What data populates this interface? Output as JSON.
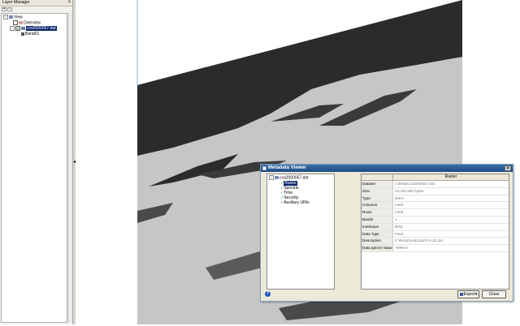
{
  "layer_manager": {
    "title": "Layer Manager",
    "close_glyph": "×",
    "toolbar": [
      "+",
      "−"
    ],
    "tree": [
      {
        "label": "View",
        "depth": 0,
        "icon": "view-icon"
      },
      {
        "label": "Overview",
        "depth": 1,
        "icon": "overview-icon"
      },
      {
        "label": "cca2000057.dat",
        "depth": 1,
        "icon": "raster-layer-icon",
        "selected": true,
        "checked": true
      },
      {
        "label": "Band01",
        "depth": 2,
        "icon": "band-icon"
      }
    ]
  },
  "metadata_viewer": {
    "title": "Metadata Viewer",
    "close_glyph": "×",
    "tree": {
      "root": "cca2000057.dat",
      "items": [
        "Raster",
        "Spectral",
        "Time",
        "Security",
        "Auxiliary URIs"
      ],
      "selected_index": 0
    },
    "grid": {
      "header": "Raster",
      "rows": [
        {
          "k": "Dataset",
          "v": "c:\\temp\\cca2000057.dat"
        },
        {
          "k": "Size",
          "v": "23,040,000 bytes"
        },
        {
          "k": "Type",
          "v": "ENVI"
        },
        {
          "k": "Columns",
          "v": "2400"
        },
        {
          "k": "Rows",
          "v": "2400"
        },
        {
          "k": "Bands",
          "v": "1"
        },
        {
          "k": "Interleave",
          "v": "BSQ"
        },
        {
          "k": "Data Type",
          "v": "Float"
        },
        {
          "k": "Description",
          "v": "C:\\temp\\mod10a2\\Y1+02.dat"
        },
        {
          "k": "Data Ignore Value",
          "v": "-9999.0"
        }
      ]
    },
    "help_glyph": "?",
    "export_label": "Export",
    "close_label": "Close"
  },
  "colors": {
    "dark_region": "#2b2b2b",
    "light_region": "#c8c8c8",
    "accent": "#0a246a"
  }
}
